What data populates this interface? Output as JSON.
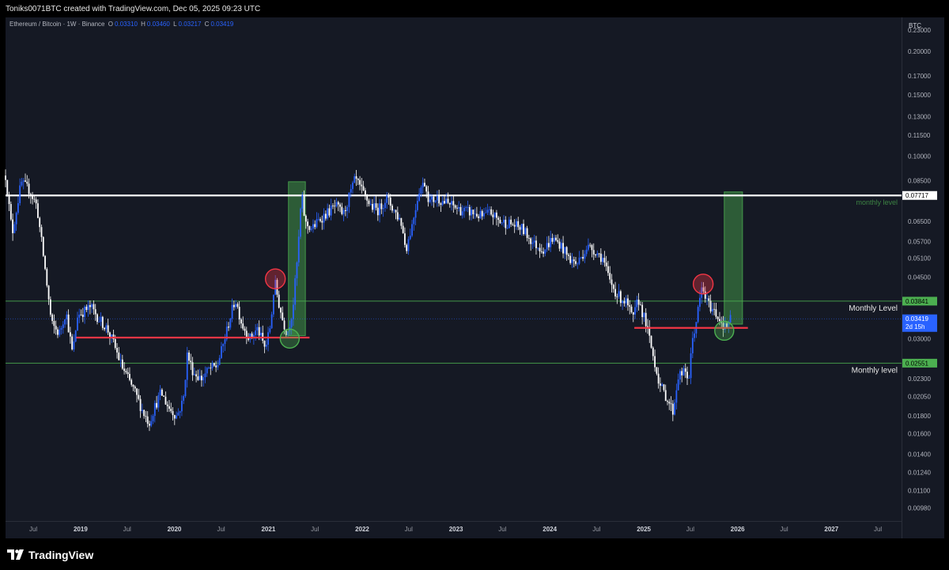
{
  "header": {
    "caption": "Toniks0071BTC created with TradingView.com, Dec 05, 2025 09:23 UTC"
  },
  "legend": {
    "symbol": "Ethereum / Bitcoin · 1W · Binance",
    "o_label": "O",
    "o_value": "0.03310",
    "h_label": "H",
    "h_value": "0.03460",
    "l_label": "L",
    "l_value": "0.03217",
    "c_label": "C",
    "c_value": "0.03419"
  },
  "footer": {
    "logo_text": "TradingView"
  },
  "colors": {
    "background": "#151924",
    "up_candle": "#2962ff",
    "down_candle": "#ffffff",
    "resistance_line": "#ffffff",
    "monthly_level_line": "#4caf50",
    "support_line": "#f23645",
    "box_fill": "#4caf50",
    "circle_red": "#f23645",
    "circle_green": "#4caf50",
    "current_price_badge": "#2962ff"
  },
  "chart_data": {
    "type": "candlestick",
    "title": "Ethereum / Bitcoin · 1W · Binance",
    "yscale": "log",
    "y_unit": "BTC",
    "ylim": [
      0.009,
      0.25
    ],
    "xlim": [
      "2018-03-15",
      "2027-10-01"
    ],
    "y_ticks": [
      "0.23000",
      "0.20000",
      "0.17000",
      "0.15000",
      "0.13000",
      "0.11500",
      "0.10000",
      "0.08500",
      "0.06500",
      "0.05700",
      "0.05100",
      "0.04500",
      "0.03000",
      "0.02300",
      "0.02050",
      "0.01800",
      "0.01600",
      "0.01400",
      "0.01240",
      "0.01100",
      "0.00980"
    ],
    "x_ticks": [
      {
        "label": "Jul",
        "date": "2018-07-01",
        "bold": false
      },
      {
        "label": "2019",
        "date": "2019-01-01",
        "bold": true
      },
      {
        "label": "Jul",
        "date": "2019-07-01",
        "bold": false
      },
      {
        "label": "2020",
        "date": "2020-01-01",
        "bold": true
      },
      {
        "label": "Jul",
        "date": "2020-07-01",
        "bold": false
      },
      {
        "label": "2021",
        "date": "2021-01-01",
        "bold": true
      },
      {
        "label": "Jul",
        "date": "2021-07-01",
        "bold": false
      },
      {
        "label": "2022",
        "date": "2022-01-01",
        "bold": true
      },
      {
        "label": "Jul",
        "date": "2022-07-01",
        "bold": false
      },
      {
        "label": "2023",
        "date": "2023-01-01",
        "bold": true
      },
      {
        "label": "Jul",
        "date": "2023-07-01",
        "bold": false
      },
      {
        "label": "2024",
        "date": "2024-01-01",
        "bold": true
      },
      {
        "label": "Jul",
        "date": "2024-07-01",
        "bold": false
      },
      {
        "label": "2025",
        "date": "2025-01-01",
        "bold": true
      },
      {
        "label": "Jul",
        "date": "2025-07-01",
        "bold": false
      },
      {
        "label": "2026",
        "date": "2026-01-01",
        "bold": true
      },
      {
        "label": "Jul",
        "date": "2026-07-01",
        "bold": false
      },
      {
        "label": "2027",
        "date": "2027-01-01",
        "bold": true
      },
      {
        "label": "Jul",
        "date": "2027-07-01",
        "bold": false
      }
    ],
    "price_path": [
      {
        "date": "2018-03-15",
        "close": 0.088
      },
      {
        "date": "2018-04-10",
        "close": 0.06
      },
      {
        "date": "2018-05-15",
        "close": 0.084
      },
      {
        "date": "2018-06-15",
        "close": 0.08
      },
      {
        "date": "2018-07-15",
        "close": 0.072
      },
      {
        "date": "2018-08-15",
        "close": 0.048
      },
      {
        "date": "2018-09-10",
        "close": 0.033
      },
      {
        "date": "2018-10-10",
        "close": 0.031
      },
      {
        "date": "2018-11-05",
        "close": 0.036
      },
      {
        "date": "2018-12-01",
        "close": 0.027
      },
      {
        "date": "2018-12-20",
        "close": 0.035
      },
      {
        "date": "2019-02-10",
        "close": 0.037
      },
      {
        "date": "2019-03-15",
        "close": 0.034
      },
      {
        "date": "2019-04-15",
        "close": 0.032
      },
      {
        "date": "2019-05-10",
        "close": 0.029
      },
      {
        "date": "2019-06-10",
        "close": 0.025
      },
      {
        "date": "2019-07-05",
        "close": 0.023
      },
      {
        "date": "2019-08-01",
        "close": 0.021
      },
      {
        "date": "2019-09-01",
        "close": 0.0185
      },
      {
        "date": "2019-09-25",
        "close": 0.0172
      },
      {
        "date": "2019-10-15",
        "close": 0.019
      },
      {
        "date": "2019-11-10",
        "close": 0.021
      },
      {
        "date": "2019-12-10",
        "close": 0.019
      },
      {
        "date": "2020-01-10",
        "close": 0.018
      },
      {
        "date": "2020-02-05",
        "close": 0.02
      },
      {
        "date": "2020-02-20",
        "close": 0.027
      },
      {
        "date": "2020-03-15",
        "close": 0.024
      },
      {
        "date": "2020-04-15",
        "close": 0.023
      },
      {
        "date": "2020-05-15",
        "close": 0.0245
      },
      {
        "date": "2020-06-15",
        "close": 0.025
      },
      {
        "date": "2020-07-10",
        "close": 0.029
      },
      {
        "date": "2020-08-05",
        "close": 0.0345
      },
      {
        "date": "2020-08-25",
        "close": 0.039
      },
      {
        "date": "2020-09-20",
        "close": 0.033
      },
      {
        "date": "2020-10-20",
        "close": 0.03
      },
      {
        "date": "2020-11-20",
        "close": 0.032
      },
      {
        "date": "2020-12-20",
        "close": 0.028
      },
      {
        "date": "2021-01-10",
        "close": 0.033
      },
      {
        "date": "2021-01-25",
        "close": 0.044
      },
      {
        "date": "2021-02-10",
        "close": 0.038
      },
      {
        "date": "2021-02-25",
        "close": 0.034
      },
      {
        "date": "2021-03-15",
        "close": 0.031
      },
      {
        "date": "2021-04-05",
        "close": 0.036
      },
      {
        "date": "2021-04-25",
        "close": 0.052
      },
      {
        "date": "2021-05-10",
        "close": 0.078
      },
      {
        "date": "2021-05-25",
        "close": 0.064
      },
      {
        "date": "2021-06-20",
        "close": 0.062
      },
      {
        "date": "2021-07-20",
        "close": 0.066
      },
      {
        "date": "2021-08-20",
        "close": 0.069
      },
      {
        "date": "2021-09-20",
        "close": 0.072
      },
      {
        "date": "2021-10-20",
        "close": 0.068
      },
      {
        "date": "2021-11-15",
        "close": 0.078
      },
      {
        "date": "2021-12-05",
        "close": 0.086
      },
      {
        "date": "2022-01-05",
        "close": 0.078
      },
      {
        "date": "2022-02-05",
        "close": 0.072
      },
      {
        "date": "2022-03-05",
        "close": 0.07
      },
      {
        "date": "2022-04-05",
        "close": 0.076
      },
      {
        "date": "2022-05-05",
        "close": 0.07
      },
      {
        "date": "2022-06-01",
        "close": 0.065
      },
      {
        "date": "2022-06-20",
        "close": 0.054
      },
      {
        "date": "2022-07-15",
        "close": 0.064
      },
      {
        "date": "2022-08-10",
        "close": 0.08
      },
      {
        "date": "2022-09-01",
        "close": 0.084
      },
      {
        "date": "2022-09-20",
        "close": 0.074
      },
      {
        "date": "2022-10-20",
        "close": 0.076
      },
      {
        "date": "2022-11-15",
        "close": 0.074
      },
      {
        "date": "2022-12-20",
        "close": 0.072
      },
      {
        "date": "2023-01-20",
        "close": 0.07
      },
      {
        "date": "2023-03-01",
        "close": 0.069
      },
      {
        "date": "2023-04-15",
        "close": 0.067
      },
      {
        "date": "2023-05-15",
        "close": 0.069
      },
      {
        "date": "2023-06-20",
        "close": 0.065
      },
      {
        "date": "2023-08-01",
        "close": 0.064
      },
      {
        "date": "2023-09-15",
        "close": 0.062
      },
      {
        "date": "2023-11-01",
        "close": 0.056
      },
      {
        "date": "2023-12-10",
        "close": 0.054
      },
      {
        "date": "2024-01-10",
        "close": 0.058
      },
      {
        "date": "2024-02-10",
        "close": 0.056
      },
      {
        "date": "2024-03-15",
        "close": 0.051
      },
      {
        "date": "2024-04-15",
        "close": 0.049
      },
      {
        "date": "2024-05-25",
        "close": 0.055
      },
      {
        "date": "2024-06-20",
        "close": 0.054
      },
      {
        "date": "2024-07-25",
        "close": 0.051
      },
      {
        "date": "2024-08-20",
        "close": 0.044
      },
      {
        "date": "2024-09-20",
        "close": 0.04
      },
      {
        "date": "2024-10-25",
        "close": 0.038
      },
      {
        "date": "2024-11-20",
        "close": 0.034
      },
      {
        "date": "2024-12-10",
        "close": 0.039
      },
      {
        "date": "2025-01-10",
        "close": 0.033
      },
      {
        "date": "2025-02-05",
        "close": 0.027
      },
      {
        "date": "2025-03-05",
        "close": 0.022
      },
      {
        "date": "2025-04-05",
        "close": 0.02
      },
      {
        "date": "2025-04-25",
        "close": 0.0185
      },
      {
        "date": "2025-05-15",
        "close": 0.0235
      },
      {
        "date": "2025-06-10",
        "close": 0.024
      },
      {
        "date": "2025-06-25",
        "close": 0.023
      },
      {
        "date": "2025-07-10",
        "close": 0.03
      },
      {
        "date": "2025-07-25",
        "close": 0.034
      },
      {
        "date": "2025-08-15",
        "close": 0.042
      },
      {
        "date": "2025-09-05",
        "close": 0.038
      },
      {
        "date": "2025-10-01",
        "close": 0.036
      },
      {
        "date": "2025-10-25",
        "close": 0.034
      },
      {
        "date": "2025-11-15",
        "close": 0.032
      },
      {
        "date": "2025-12-05",
        "close": 0.0342
      }
    ],
    "horizontal_lines": [
      {
        "kind": "resistance",
        "value": 0.07717,
        "label": "",
        "badge": "0.07717",
        "badge_color": "#ffffff",
        "badge_text_color": "#000000"
      },
      {
        "kind": "monthly-level",
        "value": 0.03841,
        "label": "Monthly Level",
        "badge": "0.03841",
        "badge_color": "#4caf50",
        "badge_text_color": "#000000"
      },
      {
        "kind": "monthly-level",
        "value": 0.02551,
        "label": "Monthly level",
        "badge": "0.02551",
        "badge_color": "#4caf50",
        "badge_text_color": "#000000"
      }
    ],
    "resistance_caption": "monthly level",
    "current_price": {
      "value": 0.03419,
      "badge": "0.03419",
      "countdown": "2d 15h"
    },
    "support_segments": [
      {
        "from": "2018-12-15",
        "to": "2021-06-10",
        "value": 0.0302
      },
      {
        "from": "2024-11-25",
        "to": "2026-02-10",
        "value": 0.0322
      }
    ],
    "boxes": [
      {
        "from": "2021-03-20",
        "to": "2021-05-25",
        "low": 0.0306,
        "high": 0.0845
      },
      {
        "from": "2025-11-10",
        "to": "2026-01-20",
        "low": 0.033,
        "high": 0.079
      }
    ],
    "circles": [
      {
        "date": "2021-01-28",
        "value": 0.0445,
        "color": "red"
      },
      {
        "date": "2021-03-25",
        "value": 0.03,
        "color": "green"
      },
      {
        "date": "2025-08-20",
        "value": 0.043,
        "color": "red"
      },
      {
        "date": "2025-11-10",
        "value": 0.0316,
        "color": "green"
      }
    ]
  }
}
